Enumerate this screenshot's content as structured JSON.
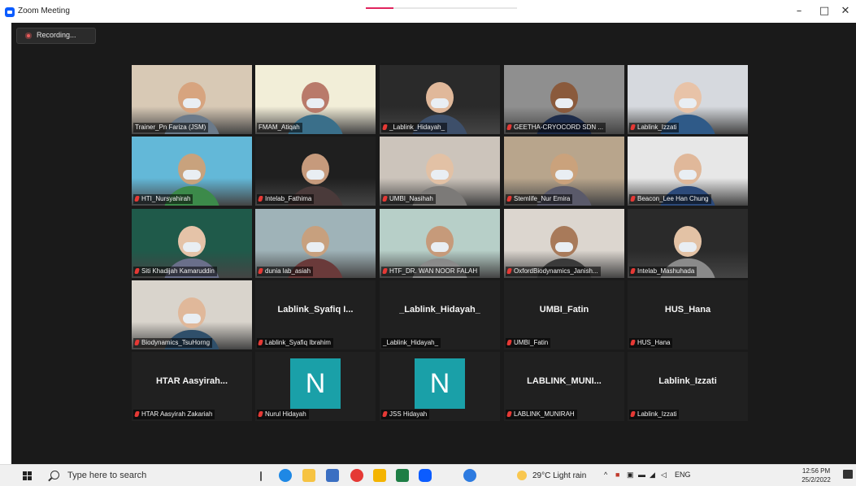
{
  "window": {
    "title": "Zoom Meeting",
    "minimize_glyph": "–",
    "maximize_glyph": "□",
    "close_glyph": "✕"
  },
  "recording": {
    "label": "Recording..."
  },
  "participants": [
    {
      "name": "Trainer_Pn Fariza (JSM)",
      "type": "video",
      "muted": false
    },
    {
      "name": "FMAM_Atiqah",
      "type": "video",
      "muted": false,
      "active_speaker": true
    },
    {
      "name": "_Lablink_Hidayah_",
      "type": "video",
      "muted": true
    },
    {
      "name": "GEETHA-CRYOCORD SDN ...",
      "type": "video",
      "muted": true
    },
    {
      "name": "Lablink_Izzati",
      "type": "video",
      "muted": true
    },
    {
      "name": "HTI_Nursyahirah",
      "type": "video",
      "muted": true
    },
    {
      "name": "Intelab_Fathima",
      "type": "video",
      "muted": true
    },
    {
      "name": "UMBI_Nasihah",
      "type": "video",
      "muted": true
    },
    {
      "name": "Stemlife_Nur Emira",
      "type": "video",
      "muted": true
    },
    {
      "name": "Beacon_Lee Han Chung",
      "type": "video",
      "muted": true
    },
    {
      "name": "Siti Khadijah Kamaruddin",
      "type": "video",
      "muted": true
    },
    {
      "name": "dunia lab_asiah",
      "type": "video",
      "muted": true
    },
    {
      "name": "HTF_DR. WAN NOOR FALAH",
      "type": "video",
      "muted": true
    },
    {
      "name": "OxfordBiodynamics_Janish...",
      "type": "video",
      "muted": true
    },
    {
      "name": "Intelab_Mashuhada",
      "type": "video",
      "muted": true
    },
    {
      "name": "Biodynamics_TsuHorng",
      "type": "video",
      "muted": true
    },
    {
      "name": "Lablink_Syafiq Ibrahim",
      "display": "Lablink_Syafiq I...",
      "type": "name",
      "muted": true
    },
    {
      "name": "_Lablink_Hidayah_",
      "display": "_Lablink_Hidayah_",
      "type": "name",
      "muted": false
    },
    {
      "name": "UMBI_Fatin",
      "display": "UMBI_Fatin",
      "type": "name",
      "muted": true
    },
    {
      "name": "HUS_Hana",
      "display": "HUS_Hana",
      "type": "name",
      "muted": true
    },
    {
      "name": "HTAR Aasyirah Zakariah",
      "display": "HTAR Aasyirah...",
      "type": "name",
      "muted": true
    },
    {
      "name": "Nurul Hidayah",
      "initial": "N",
      "type": "avatar",
      "muted": true
    },
    {
      "name": "JSS Hidayah",
      "initial": "N",
      "type": "avatar",
      "muted": true
    },
    {
      "name": "LABLINK_MUNIRAH",
      "display": "LABLINK_MUNI...",
      "type": "name",
      "muted": true
    },
    {
      "name": "Lablink_Izzati",
      "display": "Lablink_Izzati",
      "type": "name",
      "muted": true
    }
  ],
  "taskbar": {
    "search_placeholder": "Type here to search",
    "weather": "29°C  Light rain",
    "language": "ENG",
    "time": "12:56 PM",
    "date": "25/2/2022"
  },
  "colors": {
    "meeting_bg": "#1a1a1a",
    "active_speaker": "#c6e03d",
    "avatar_bg": "#1aa0a8",
    "muted_mic": "#e53935"
  }
}
